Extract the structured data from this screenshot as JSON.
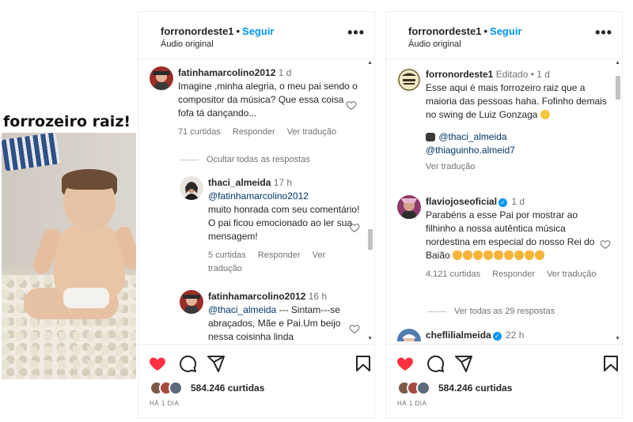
{
  "video": {
    "caption": "forrozeiro raiz!"
  },
  "post_header": {
    "username": "forronordeste1",
    "follow_label": "Seguir",
    "audio": "Áudio original"
  },
  "panel1": {
    "comments": [
      {
        "user": "fatinhamarcolino2012",
        "time": "1 d",
        "text": "Imagine ,minha alegria, o meu pai sendo o compositor da música? Que essa coisa fofa tá dançando...",
        "likes": "71 curtidas",
        "reply": "Responder",
        "translate": "Ver tradução"
      }
    ],
    "hide_replies": "Ocultar todas as respostas",
    "replies": [
      {
        "user": "thaci_almeida",
        "time": "17 h",
        "mention": "@fatinhamarcolino2012",
        "text": "muito honrada com seu comentário! O pai ficou emocionado ao ler sua mensagem!",
        "likes": "5 curtidas",
        "reply": "Responder",
        "translate": "Ver tradução"
      },
      {
        "user": "fatinhamarcolino2012",
        "time": "16 h",
        "mention": "@thaci_almeida",
        "text": "--- Sintam---se abraçados, Mãe e Pai.Um beijo nessa coisinha linda"
      }
    ]
  },
  "panel2": {
    "caption_comment": {
      "user": "forronordeste1",
      "edited": "Editado",
      "time": "1 d",
      "text": "Esse aqui é mais forrozeiro raiz que a maioria das pessoas haha. Fofinho demais no swing de Luiz Gonzaga",
      "tag1": "@thaci_almeida",
      "tag2": "@thiaguinho.almeid7",
      "translate": "Ver tradução"
    },
    "comments": [
      {
        "user": "flaviojoseoficial",
        "time": "1 d",
        "text": "Parabéns a esse Pai por mostrar ao filhinho a nossa autêntica música nordestina em especial do nosso Rei do Baião",
        "likes": "4.121 curtidas",
        "reply": "Responder",
        "translate": "Ver tradução"
      }
    ],
    "view_replies": "Ver todas as 29 respostas",
    "next_comment": {
      "user": "cheflilialmeida",
      "time": "22 h"
    }
  },
  "footer": {
    "likes": "584.246 curtidas",
    "date": "HÁ 1 DIA"
  },
  "colors": {
    "like_red": "#ff3040",
    "link_blue": "#0095f6",
    "mention": "#00376b"
  },
  "icons": [
    "heart-icon",
    "comment-icon",
    "share-icon",
    "save-icon",
    "more-icon",
    "verified-icon"
  ]
}
